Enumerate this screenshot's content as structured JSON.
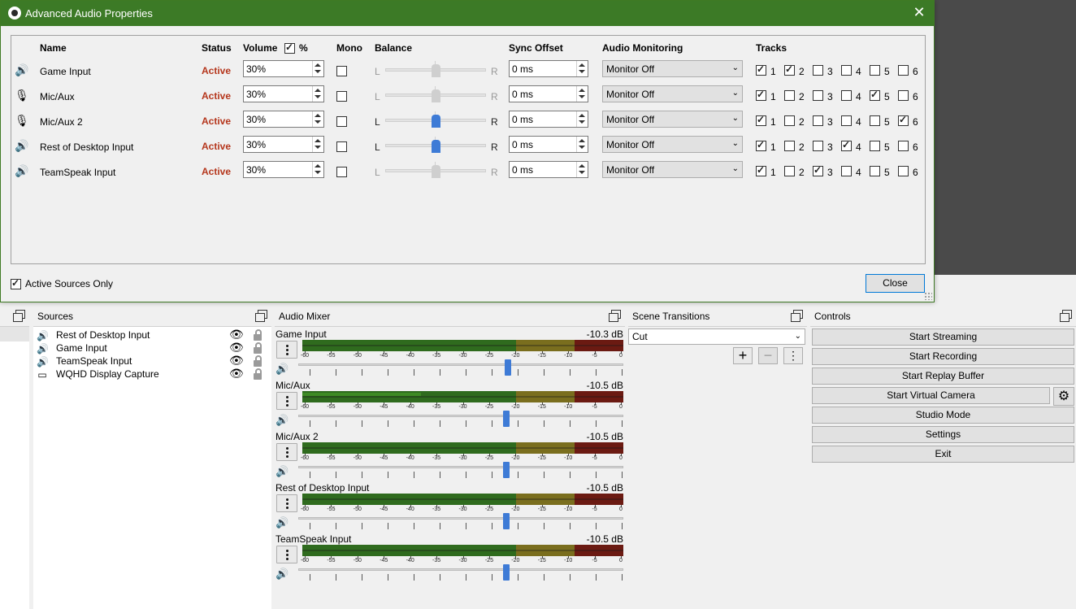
{
  "dialog": {
    "title": "Advanced Audio Properties",
    "headers": {
      "name": "Name",
      "status": "Status",
      "volume": "Volume",
      "percent": "%",
      "mono": "Mono",
      "balance": "Balance",
      "sync_offset": "Sync Offset",
      "audio_monitoring": "Audio Monitoring",
      "tracks": "Tracks"
    },
    "rows": [
      {
        "name": "Game Input",
        "icon": "speaker-icon",
        "status": "Active",
        "volume": "30%",
        "mono": false,
        "balance_l": "L",
        "balance_r": "R",
        "balance_enabled": false,
        "balance_value": 0.5,
        "sync_offset": "0 ms",
        "monitoring": "Monitor Off",
        "tracks": [
          true,
          true,
          false,
          false,
          false,
          false
        ]
      },
      {
        "name": "Mic/Aux",
        "icon": "microphone-icon",
        "status": "Active",
        "volume": "30%",
        "mono": false,
        "balance_l": "L",
        "balance_r": "R",
        "balance_enabled": false,
        "balance_value": 0.5,
        "sync_offset": "0 ms",
        "monitoring": "Monitor Off",
        "tracks": [
          true,
          false,
          false,
          false,
          true,
          false
        ]
      },
      {
        "name": "Mic/Aux 2",
        "icon": "microphone-icon",
        "status": "Active",
        "volume": "30%",
        "mono": false,
        "balance_l": "L",
        "balance_r": "R",
        "balance_enabled": true,
        "balance_value": 0.5,
        "sync_offset": "0 ms",
        "monitoring": "Monitor Off",
        "tracks": [
          true,
          false,
          false,
          false,
          false,
          true
        ]
      },
      {
        "name": "Rest of Desktop Input",
        "icon": "speaker-icon",
        "status": "Active",
        "volume": "30%",
        "mono": false,
        "balance_l": "L",
        "balance_r": "R",
        "balance_enabled": true,
        "balance_value": 0.5,
        "sync_offset": "0 ms",
        "monitoring": "Monitor Off",
        "tracks": [
          true,
          false,
          false,
          true,
          false,
          false
        ]
      },
      {
        "name": "TeamSpeak Input",
        "icon": "speaker-icon",
        "status": "Active",
        "volume": "30%",
        "mono": false,
        "balance_l": "L",
        "balance_r": "R",
        "balance_enabled": false,
        "balance_value": 0.5,
        "sync_offset": "0 ms",
        "monitoring": "Monitor Off",
        "tracks": [
          true,
          false,
          true,
          false,
          false,
          false
        ]
      }
    ],
    "track_labels": [
      "1",
      "2",
      "3",
      "4",
      "5",
      "6"
    ],
    "active_sources_only_label": "Active Sources Only",
    "active_sources_only": true,
    "close_label": "Close",
    "volume_percent_checked": true
  },
  "sources": {
    "title": "Sources",
    "items": [
      {
        "name": "Rest of Desktop Input",
        "icon": "speaker-icon"
      },
      {
        "name": "Game Input",
        "icon": "speaker-icon"
      },
      {
        "name": "TeamSpeak Input",
        "icon": "speaker-icon"
      },
      {
        "name": "WQHD Display Capture",
        "icon": "monitor-icon"
      }
    ]
  },
  "mixer": {
    "title": "Audio Mixer",
    "scale_labels": [
      "-60",
      "-55",
      "-50",
      "-45",
      "-40",
      "-35",
      "-30",
      "-25",
      "-20",
      "-15",
      "-10",
      "-5",
      "0"
    ],
    "channels": [
      {
        "name": "Game Input",
        "db": "-10.3 dB",
        "fader": 0.645,
        "level": 0.0
      },
      {
        "name": "Mic/Aux",
        "db": "-10.5 dB",
        "fader": 0.64,
        "level": 0.37
      },
      {
        "name": "Mic/Aux 2",
        "db": "-10.5 dB",
        "fader": 0.64,
        "level": 0.0
      },
      {
        "name": "Rest of Desktop Input",
        "db": "-10.5 dB",
        "fader": 0.64,
        "level": 0.0
      },
      {
        "name": "TeamSpeak Input",
        "db": "-10.5 dB",
        "fader": 0.64,
        "level": 0.0
      }
    ]
  },
  "transitions": {
    "title": "Scene Transitions",
    "selected": "Cut"
  },
  "controls": {
    "title": "Controls",
    "buttons": [
      "Start Streaming",
      "Start Recording",
      "Start Replay Buffer",
      "Start Virtual Camera",
      "Studio Mode",
      "Settings",
      "Exit"
    ]
  },
  "colors": {
    "titlebar": "#3c7a26",
    "status_active": "#b5361c",
    "meter_green": "#2f6b1e",
    "meter_yellow": "#7a6e1e",
    "meter_red": "#6b1a12",
    "fader_blue": "#3e7bd6"
  }
}
